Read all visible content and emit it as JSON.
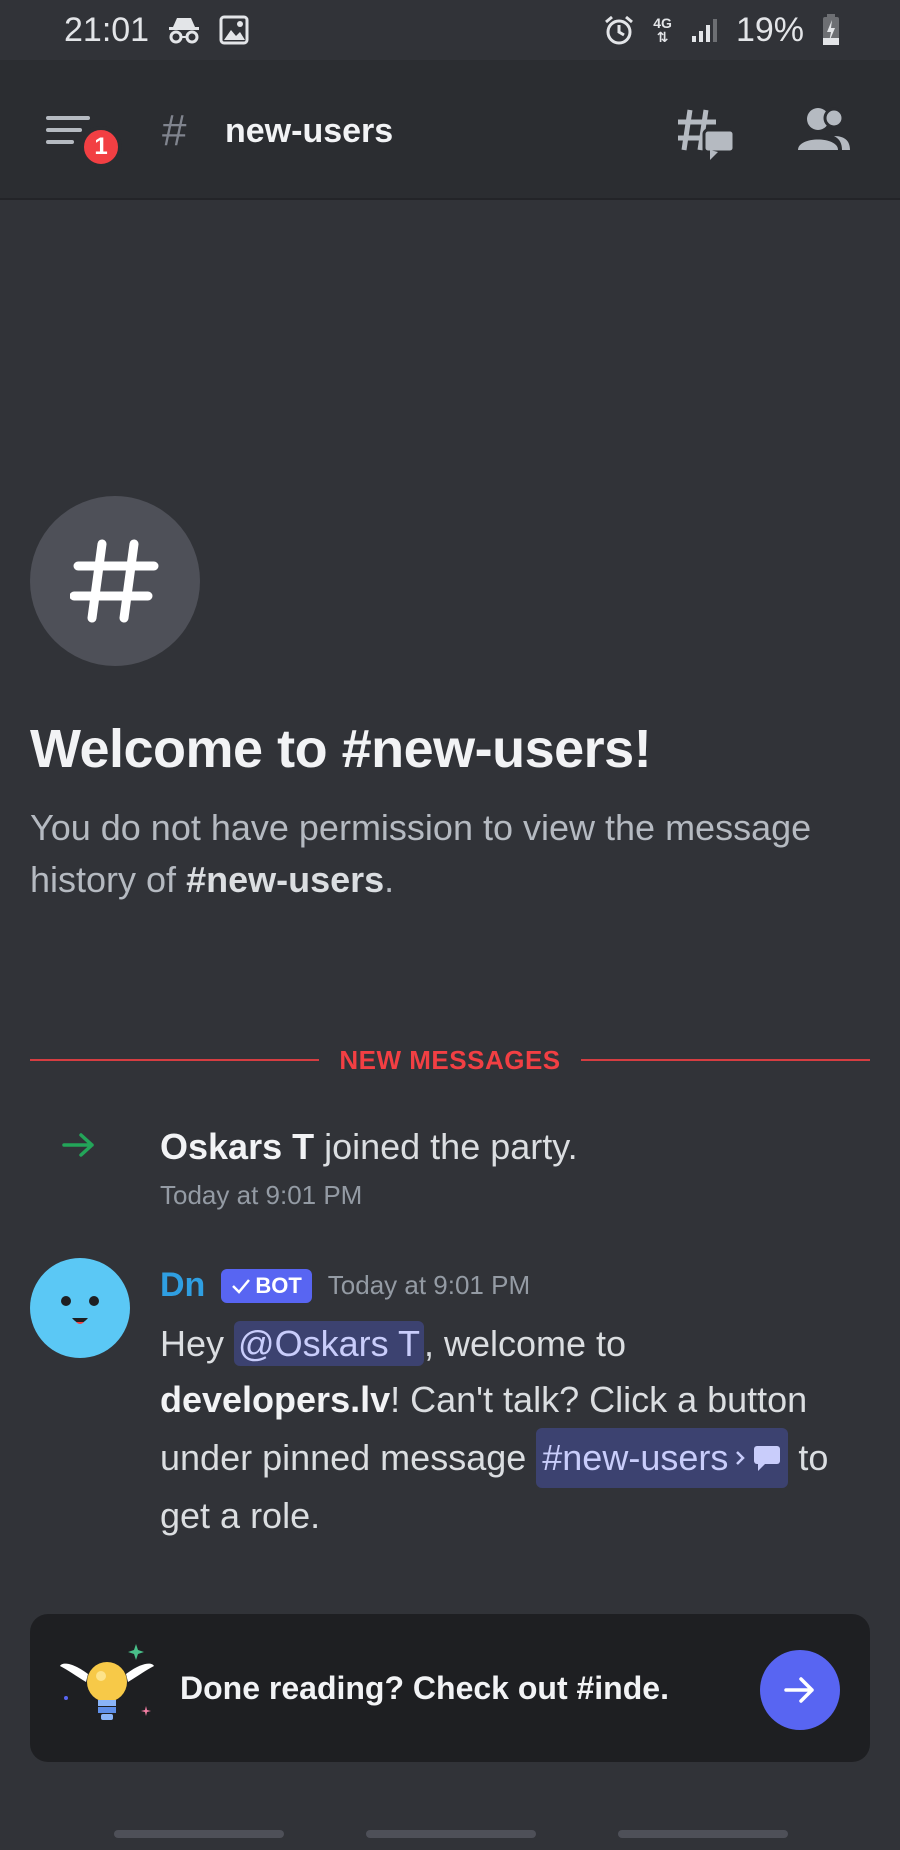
{
  "status_bar": {
    "time": "21:01",
    "network": "4G",
    "battery": "19%",
    "icons": [
      "incognito-icon",
      "image-icon",
      "alarm-icon",
      "signal-icon",
      "battery-charging-icon"
    ]
  },
  "header": {
    "channel_hash": "#",
    "channel_name": "new-users",
    "menu_badge": "1",
    "icons": [
      "menu-icon",
      "threads-icon",
      "members-icon"
    ]
  },
  "welcome": {
    "icon_glyph": "#",
    "title": "Welcome to #new-users!",
    "subtitle_prefix": "You do not have permission to view the message history of ",
    "subtitle_channel": "#new-users",
    "subtitle_suffix": "."
  },
  "divider": {
    "label": "NEW MESSAGES"
  },
  "join_event": {
    "user": "Oskars T",
    "text": " joined the party.",
    "timestamp": "Today at 9:01 PM"
  },
  "message": {
    "author": "Dn",
    "bot_label": "BOT",
    "timestamp": "Today at 9:01 PM",
    "part1": "Hey ",
    "mention": "@Oskars T",
    "part2": ", welcome to ",
    "bold": "developers.lv",
    "part3": "! Can't talk? Click a button under pinned message ",
    "channel_link": "#new-users",
    "part4": " to get a role.",
    "colors": {
      "author": "#2f9fe2",
      "bot_tag": "#5865f2",
      "avatar": "#5bc8f5"
    }
  },
  "cta": {
    "text": "Done reading? Check out #inde."
  },
  "colors": {
    "background": "#313338",
    "header": "#2b2d31",
    "accent": "#5865f2",
    "new_messages": "#f23f43",
    "join_arrow": "#23a559"
  }
}
